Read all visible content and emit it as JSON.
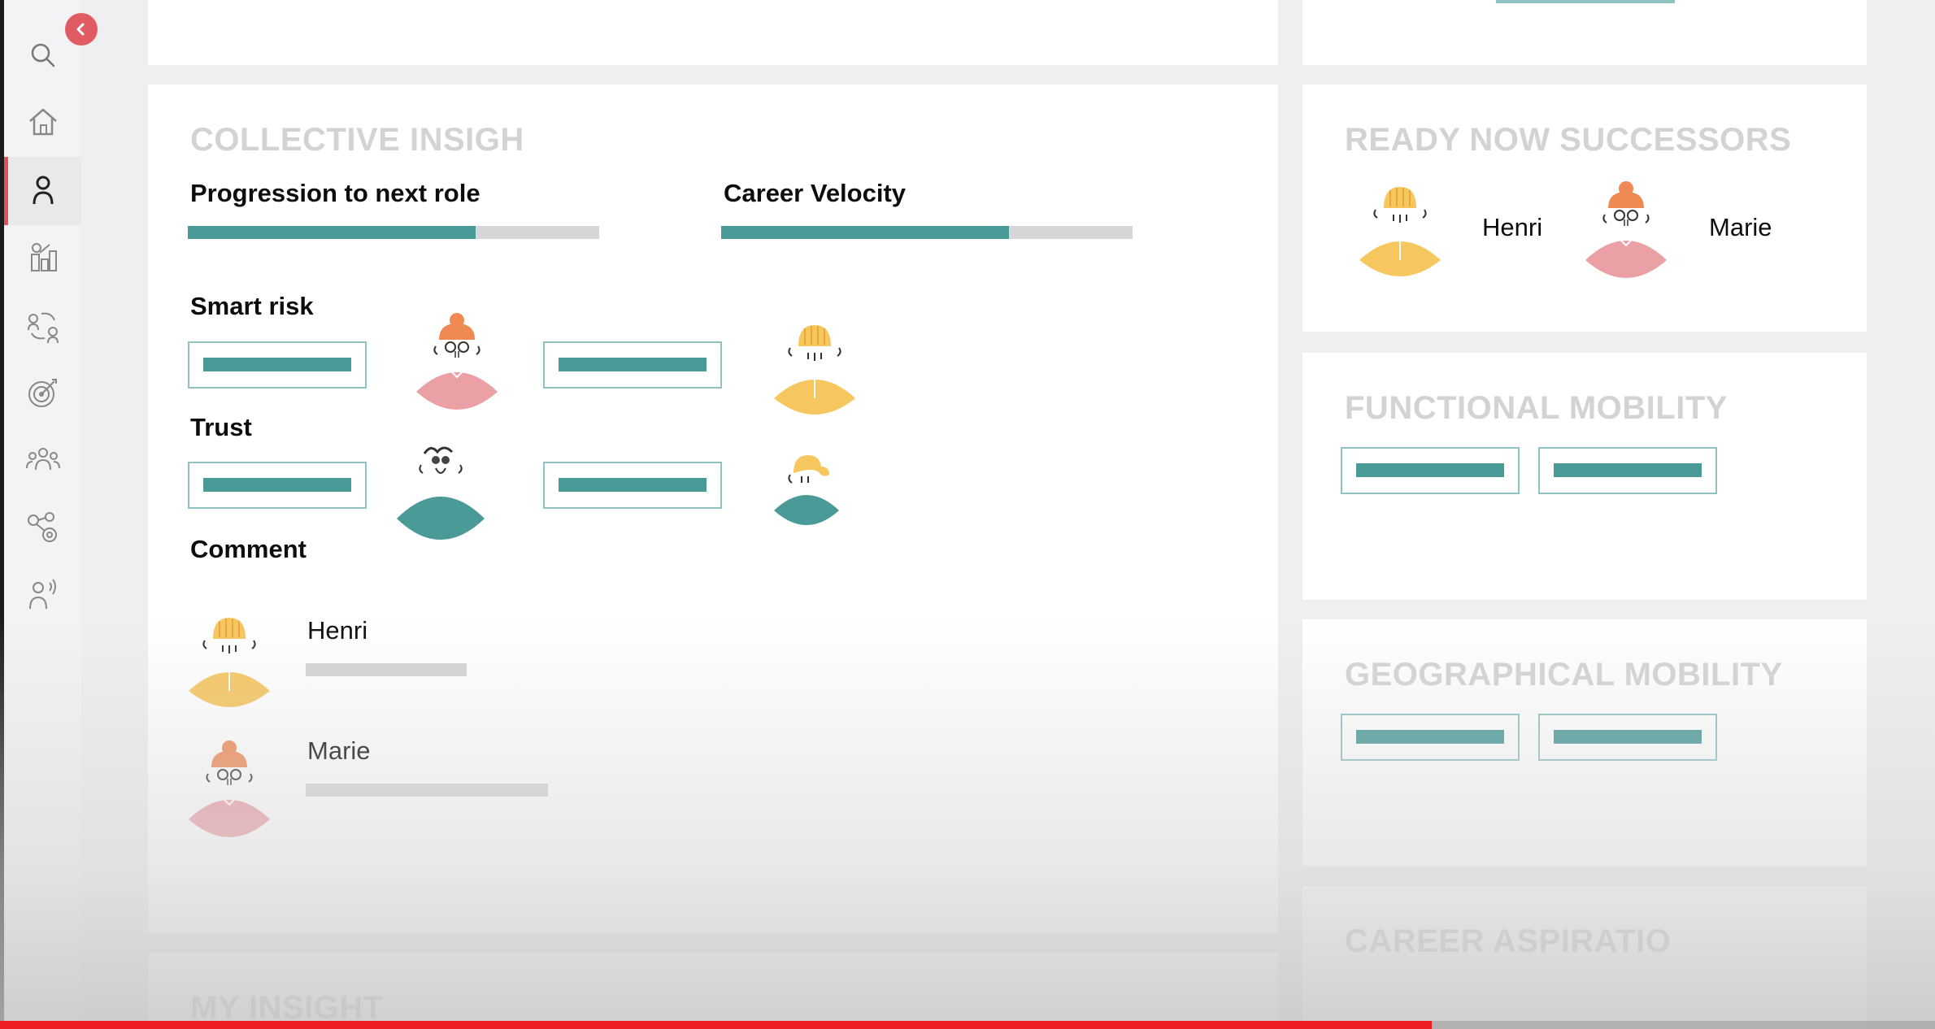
{
  "sidebar": {
    "items": [
      {
        "icon": "search-icon"
      },
      {
        "icon": "home-icon"
      },
      {
        "icon": "person-icon",
        "active": true
      },
      {
        "icon": "chart-people-icon"
      },
      {
        "icon": "people-exchange-icon"
      },
      {
        "icon": "target-icon"
      },
      {
        "icon": "group-icon"
      },
      {
        "icon": "network-icon"
      },
      {
        "icon": "broadcast-person-icon"
      }
    ],
    "collapse_icon": "chevron-left-icon"
  },
  "collective": {
    "title": "COLLECTIVE INSIGH",
    "progression_label": "Progression to next role",
    "progression_value": 0.7,
    "velocity_label": "Career Velocity",
    "velocity_value": 0.7,
    "smart_risk_label": "Smart risk",
    "trust_label": "Trust",
    "comment_label": "Comment",
    "comments": [
      {
        "name": "Henri",
        "avatar": "henri-avatar"
      },
      {
        "name": "Marie",
        "avatar": "marie-avatar"
      }
    ]
  },
  "successors": {
    "title": "READY NOW SUCCESSORS",
    "people": [
      {
        "name": "Henri"
      },
      {
        "name": "Marie"
      }
    ]
  },
  "functional": {
    "title": "FUNCTIONAL MOBILITY"
  },
  "geographical": {
    "title": "GEOGRAPHICAL MOBILITY"
  },
  "aspiration": {
    "title": "CAREER ASPIRATIO"
  },
  "my_insight": {
    "title": "MY INSIGHT"
  },
  "colors": {
    "accent": "#e2525d",
    "teal": "#4a9a98",
    "yellow": "#f6c65f",
    "pink": "#eba0a6",
    "orange": "#ef8a55"
  },
  "video_progress": 0.74
}
